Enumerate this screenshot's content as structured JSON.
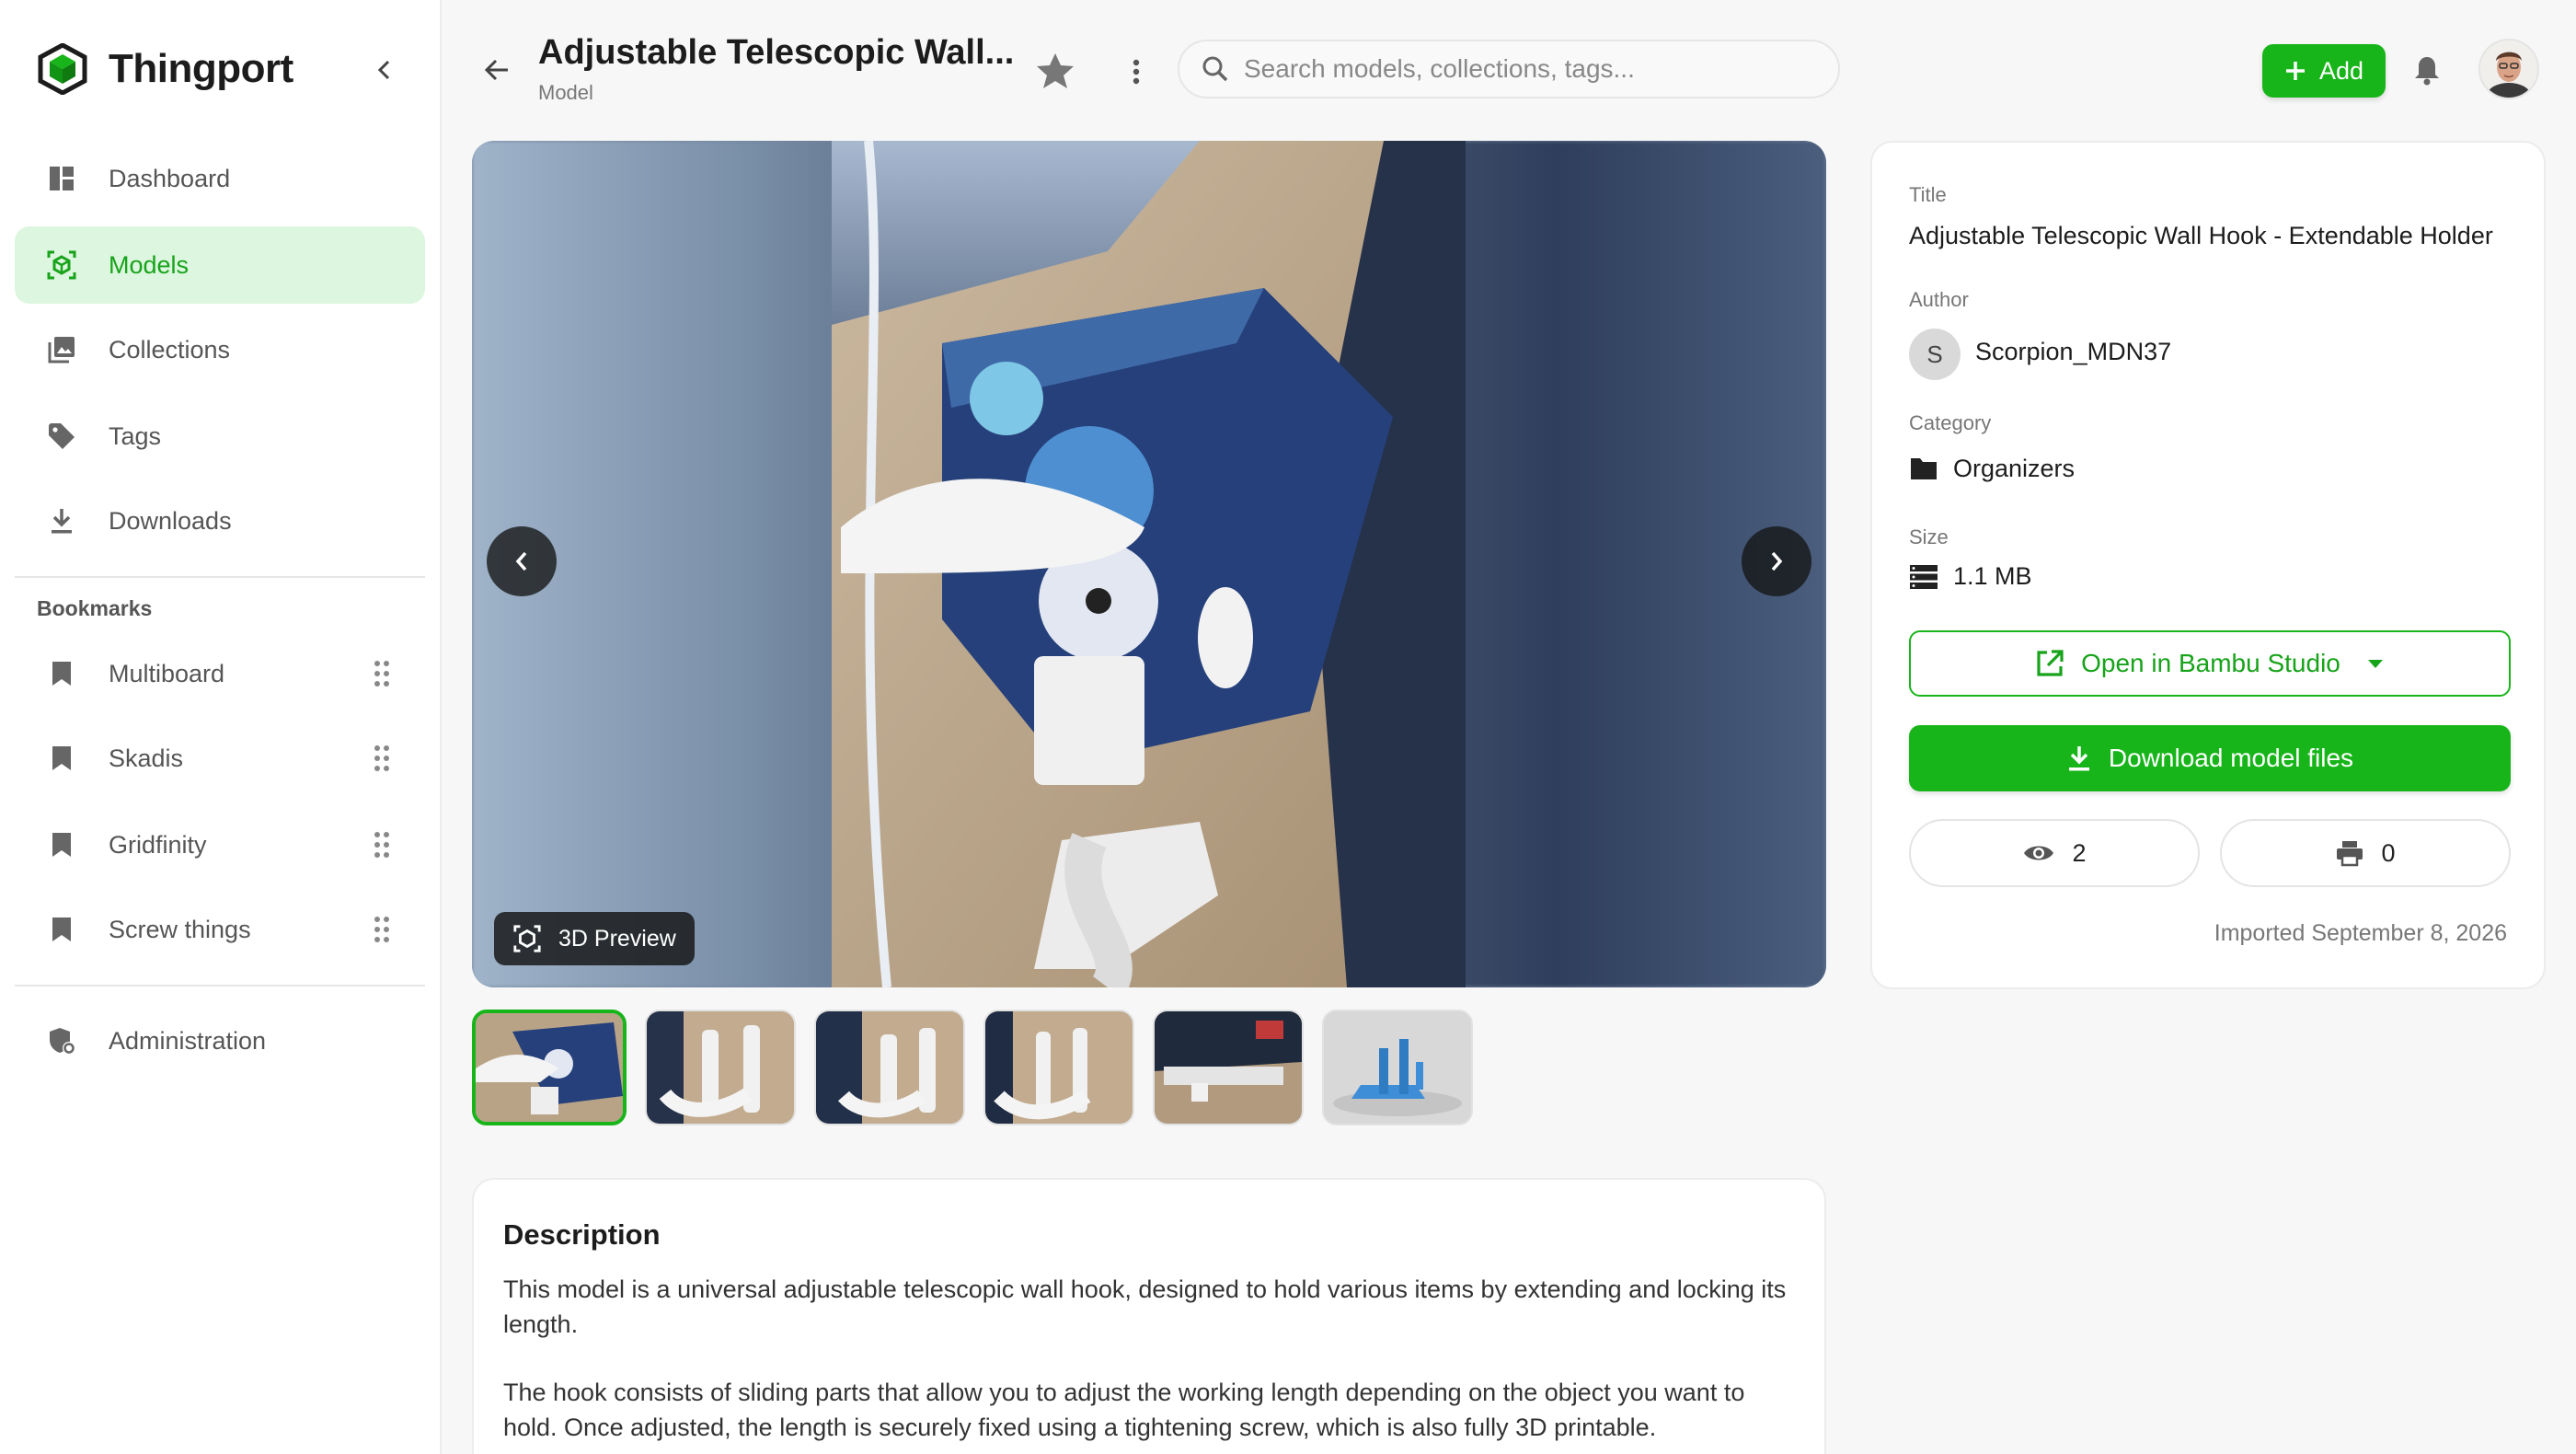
{
  "brand": {
    "name": "Thingport",
    "accent": "#17b51a"
  },
  "nav": {
    "items": [
      {
        "label": "Dashboard",
        "icon": "dashboard-icon"
      },
      {
        "label": "Models",
        "icon": "models-icon",
        "active": true
      },
      {
        "label": "Collections",
        "icon": "collections-icon"
      },
      {
        "label": "Tags",
        "icon": "tag-icon"
      },
      {
        "label": "Downloads",
        "icon": "download-icon"
      }
    ],
    "bookmarks_label": "Bookmarks",
    "bookmarks": [
      {
        "label": "Multiboard"
      },
      {
        "label": "Skadis"
      },
      {
        "label": "Gridfinity"
      },
      {
        "label": "Screw things"
      }
    ],
    "admin_label": "Administration"
  },
  "header": {
    "title": "Adjustable Telescopic Wall...",
    "subtitle": "Model",
    "search_placeholder": "Search models, collections, tags...",
    "add_label": "Add"
  },
  "gallery": {
    "preview_label": "3D Preview",
    "thumbnail_count": 6,
    "active_thumbnail": 1
  },
  "description": {
    "title": "Description",
    "paragraphs": [
      "This model is a universal adjustable telescopic wall hook, designed to hold various items by extending and locking its length.",
      "The hook consists of sliding parts that allow you to adjust the working length depending on the object you want to hold. Once adjusted, the length is securely fixed using a tightening screw, which is also fully 3D printable."
    ]
  },
  "details": {
    "title_label": "Title",
    "title_value": "Adjustable Telescopic Wall Hook - Extendable Holder",
    "author_label": "Author",
    "author_initial": "S",
    "author_name": "Scorpion_MDN37",
    "category_label": "Category",
    "category_value": "Organizers",
    "size_label": "Size",
    "size_value": "1.1 MB",
    "open_label": "Open in Bambu Studio",
    "download_label": "Download model files",
    "views": "2",
    "prints": "0",
    "imported": "Imported September 8, 2026"
  }
}
